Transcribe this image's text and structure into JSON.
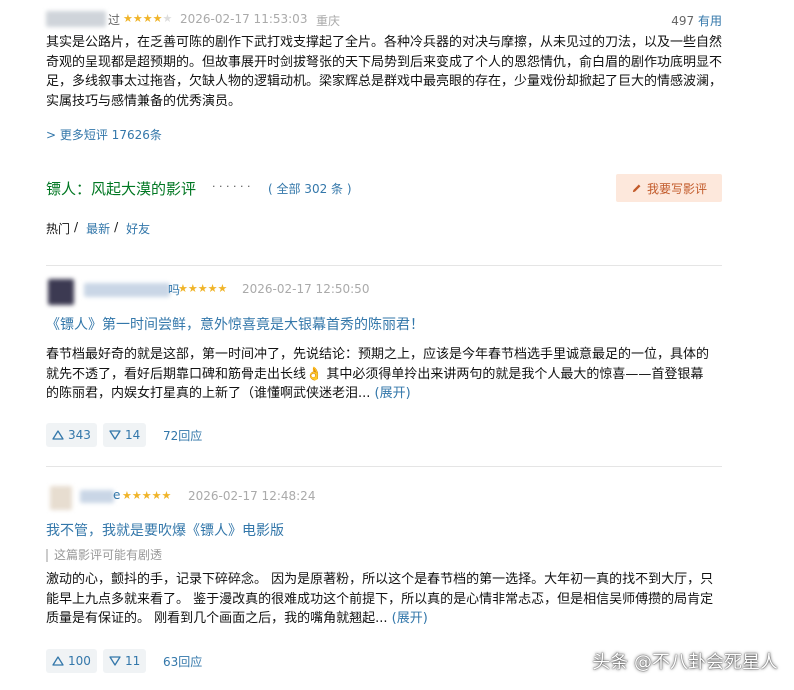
{
  "top_review": {
    "user": "████████过",
    "stars": 4,
    "datetime": "2026-02-17 11:53:03",
    "location": "重庆",
    "useful_count": "497",
    "useful_label": "有用",
    "text": "其实是公路片，在乏善可陈的剧作下武打戏支撑起了全片。各种冷兵器的对决与摩擦，从未见过的刀法，以及一些自然奇观的呈现都是超预期的。但故事展开时剑拔弩张的天下局势到后来变成了个人的恩怨情仇，俞白眉的剧作功底明显不足，多线叙事太过拖沓，欠缺人物的逻辑动机。梁家辉总是群戏中最亮眼的存在，少量戏份却掀起了巨大的情感波澜，实属技巧与感情兼备的优秀演员。"
  },
  "more_short_reviews": "> 更多短评 17626条",
  "section": {
    "title": "镖人：风起大漠的影评",
    "dots": "· · · · · ·",
    "count": "( 全部 302 条 )",
    "write_button": "我要写影评"
  },
  "filters": [
    {
      "label": "热门",
      "sep": "/"
    },
    {
      "label": "最新",
      "sep": "/"
    },
    {
      "label": "好友",
      "sep": ""
    }
  ],
  "reviews": [
    {
      "user": "██████████吗",
      "stars": 5,
      "datetime": "2026-02-17 12:50:50",
      "title": "《镖人》第一时间尝鲜，意外惊喜竟是大银幕首秀的陈丽君！",
      "spoiler": "",
      "text": "春节档最好奇的就是这部，第一时间冲了，先说结论：预期之上，应该是今年春节档选手里诚意最足的一位，具体的就先不透了，看好后期靠口碑和筋骨走出长线👌 其中必须得单拎出来讲两句的就是我个人最大的惊喜——首登银幕的陈丽君，内娱女打星真的上新了（谁懂啊武侠迷老泪...",
      "expand": "(展开)",
      "up": "343",
      "down": "14",
      "replies": "72回应"
    },
    {
      "user": "█████e",
      "stars": 5,
      "datetime": "2026-02-17 12:48:24",
      "title": "我不管，我就是要吹爆《镖人》电影版",
      "spoiler": "这篇影评可能有剧透",
      "text": "激动的心，颤抖的手，记录下碎碎念。 因为是原著粉，所以这个是春节档的第一选择。大年初一真的找不到大厅，只能早上九点多就来看了。 鉴于漫改真的很难成功这个前提下，所以真的是心情非常忐忑，但是相信吴师傅攒的局肯定质量是有保证的。 刚看到几个画面之后，我的嘴角就翘起...",
      "expand": "(展开)",
      "up": "100",
      "down": "11",
      "replies": "63回应"
    }
  ],
  "watermark": "头条 @不八卦会死星人",
  "colors": {
    "green": "#007722",
    "link": "#3377aa",
    "star": "#f0b429",
    "button_bg": "#fde8dc",
    "button_text": "#c25a2a"
  }
}
